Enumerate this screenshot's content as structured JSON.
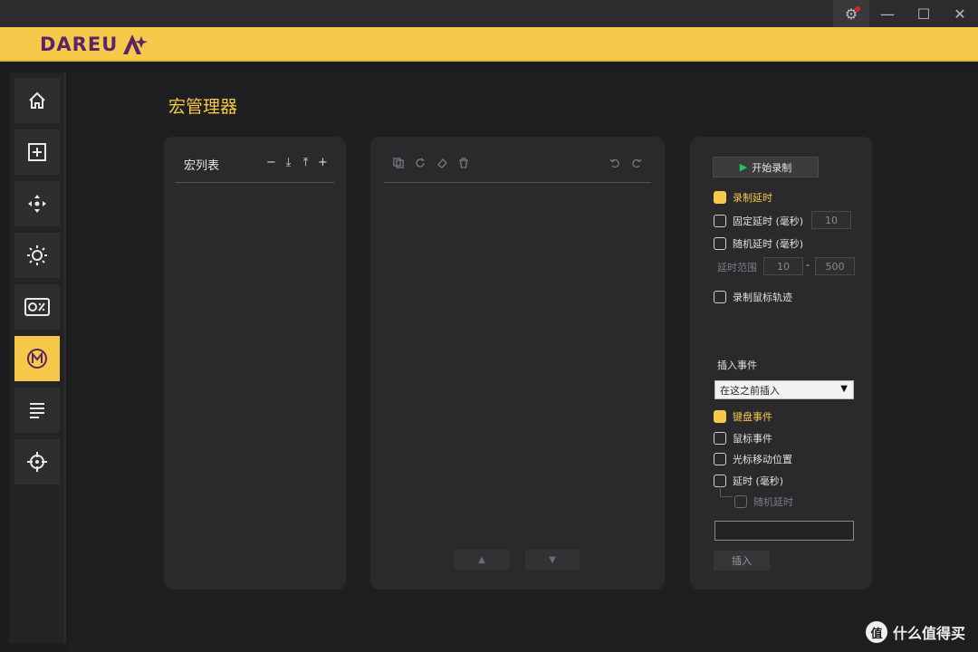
{
  "window": {
    "controls": {
      "settings_icon": "gear-icon",
      "minimize": "—",
      "maximize": "☐",
      "close": "✕"
    }
  },
  "brand": {
    "logo_text": "DAREU",
    "logo_mark": "A"
  },
  "sidebar": {
    "items": [
      {
        "icon": "home-icon",
        "active": false
      },
      {
        "icon": "plus-square-icon",
        "active": false
      },
      {
        "icon": "dpad-icon",
        "active": false
      },
      {
        "icon": "sun-icon",
        "active": false
      },
      {
        "icon": "percent-card-icon",
        "active": false
      },
      {
        "icon": "macro-m-icon",
        "active": true
      },
      {
        "icon": "lines-icon",
        "active": false
      },
      {
        "icon": "crosshair-icon",
        "active": false
      }
    ]
  },
  "page": {
    "title": "宏管理器"
  },
  "macro_list": {
    "title": "宏列表",
    "tools": [
      "−",
      "⤓",
      "⤒",
      "+"
    ]
  },
  "editor": {
    "tools_left": [
      "copy-icon",
      "redo-circle-icon",
      "eraser-icon",
      "trash-icon"
    ],
    "tools_right": [
      "undo-icon",
      "redo-icon"
    ],
    "up_label": "▲",
    "down_label": "▼"
  },
  "settings": {
    "record_button": "开始录制",
    "record_delay": {
      "label": "录制延时",
      "checked": true
    },
    "fixed_delay": {
      "label": "固定延时 (毫秒)",
      "checked": false,
      "value": "10"
    },
    "random_delay": {
      "label": "随机延时 (毫秒)",
      "checked": false
    },
    "delay_range": {
      "label": "延时范围",
      "min": "10",
      "sep": "-",
      "max": "500"
    },
    "record_mouse": {
      "label": "录制鼠标轨迹",
      "checked": false
    },
    "insert_event": {
      "title": "插入事件",
      "position_selected": "在这之前插入",
      "keyboard": {
        "label": "键盘事件",
        "checked": true
      },
      "mouse": {
        "label": "鼠标事件",
        "checked": false
      },
      "cursor": {
        "label": "光标移动位置",
        "checked": false
      },
      "delay": {
        "label": "延时 (毫秒)",
        "checked": false
      },
      "random_delay": {
        "label": "随机延时",
        "checked": false
      },
      "insert_button": "插入"
    }
  },
  "watermark": {
    "logo": "值",
    "text": "什么值得买"
  },
  "colors": {
    "accent": "#f6c94a",
    "brand": "#5a2468",
    "panel": "#2a292c",
    "play": "#22c55e"
  }
}
